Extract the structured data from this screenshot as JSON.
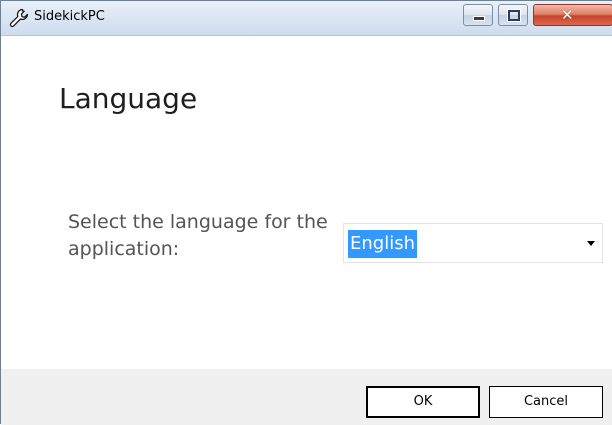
{
  "window": {
    "title": "SidekickPC",
    "icon": "wrench-icon",
    "controls": {
      "minimize": "minimize",
      "maximize": "maximize",
      "close": "✕"
    },
    "close_color": "#c8442c"
  },
  "page": {
    "heading": "Language",
    "prompt": "Select the language for the application:",
    "language_select": {
      "selected": "English",
      "selection_color": "#3399ff"
    }
  },
  "footer": {
    "ok_label": "OK",
    "cancel_label": "Cancel"
  }
}
